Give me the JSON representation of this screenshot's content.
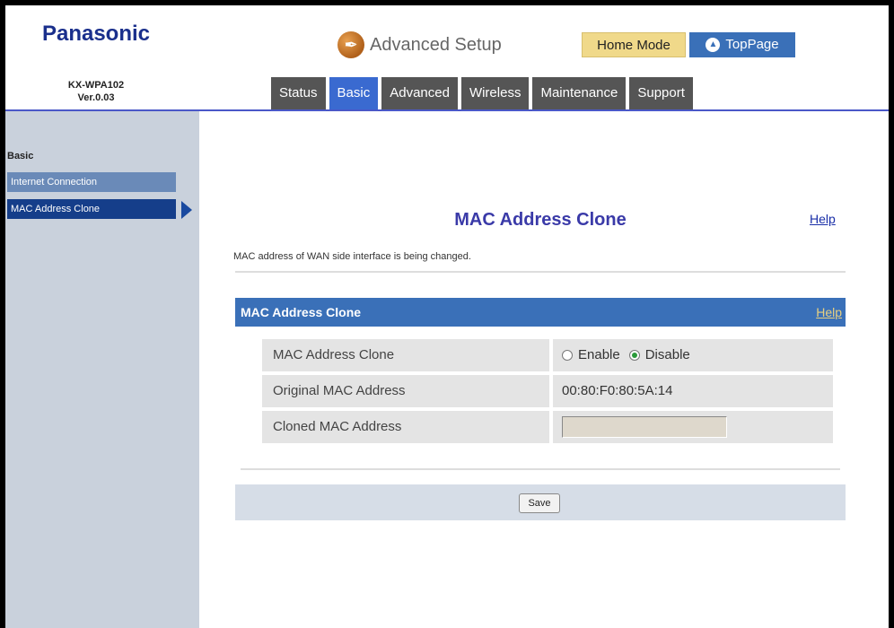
{
  "header": {
    "brand": "Panasonic",
    "model": "KX-WPA102",
    "version": "Ver.0.03",
    "title": "Advanced Setup",
    "home_mode": "Home Mode",
    "top_page": "TopPage"
  },
  "tabs": [
    {
      "label": "Status"
    },
    {
      "label": "Basic"
    },
    {
      "label": "Advanced"
    },
    {
      "label": "Wireless"
    },
    {
      "label": "Maintenance"
    },
    {
      "label": "Support"
    }
  ],
  "sidebar": {
    "title": "Basic",
    "items": [
      {
        "label": "Internet Connection"
      },
      {
        "label": "MAC Address Clone"
      }
    ]
  },
  "main": {
    "title": "MAC Address Clone",
    "help": "Help",
    "description": "MAC address of WAN side interface is being changed.",
    "section_title": "MAC Address Clone",
    "section_help": "Help",
    "rows": {
      "clone_label": "MAC Address Clone",
      "enable_label": "Enable",
      "disable_label": "Disable",
      "original_label": "Original MAC Address",
      "original_value": "00:80:F0:80:5A:14",
      "cloned_label": "Cloned MAC Address",
      "cloned_value": ""
    },
    "save_label": "Save"
  },
  "colors": {
    "brand": "#1a2f8c",
    "tab_active": "#3a6ad0",
    "section_bar": "#3a70b8",
    "sidebar_bg": "#c9d1dc",
    "sidebar_selected": "#153e8a"
  }
}
